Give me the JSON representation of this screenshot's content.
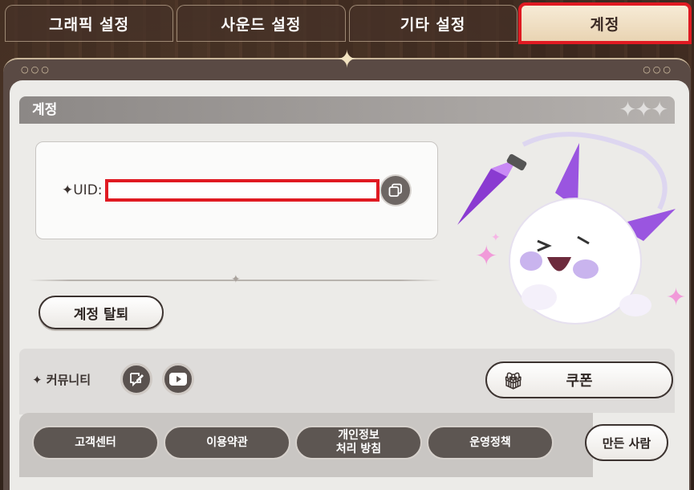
{
  "tabs": [
    {
      "label": "그래픽 설정"
    },
    {
      "label": "사운드 설정"
    },
    {
      "label": "기타 설정"
    },
    {
      "label": "계정"
    }
  ],
  "section": {
    "title": "계정"
  },
  "uid": {
    "label": "✦UID:",
    "value": ""
  },
  "account": {
    "withdraw_label": "계정 탈퇴"
  },
  "community": {
    "label": "✦  커뮤니티",
    "coupon_label": "쿠폰"
  },
  "footer": {
    "buttons": [
      {
        "label": "고객센터"
      },
      {
        "label": "이용약관"
      },
      {
        "label": "개인정보\n처리 방침"
      },
      {
        "label": "운영정책"
      }
    ],
    "credits_label": "만든 사람"
  },
  "icons": {
    "copy": "copy-icon",
    "forum": "edit-chat-icon",
    "video": "youtube-icon",
    "gift": "gift-icon"
  },
  "colors": {
    "highlight": "#e01a22",
    "panel": "#ecebe8",
    "dark_button": "#5d5652"
  }
}
